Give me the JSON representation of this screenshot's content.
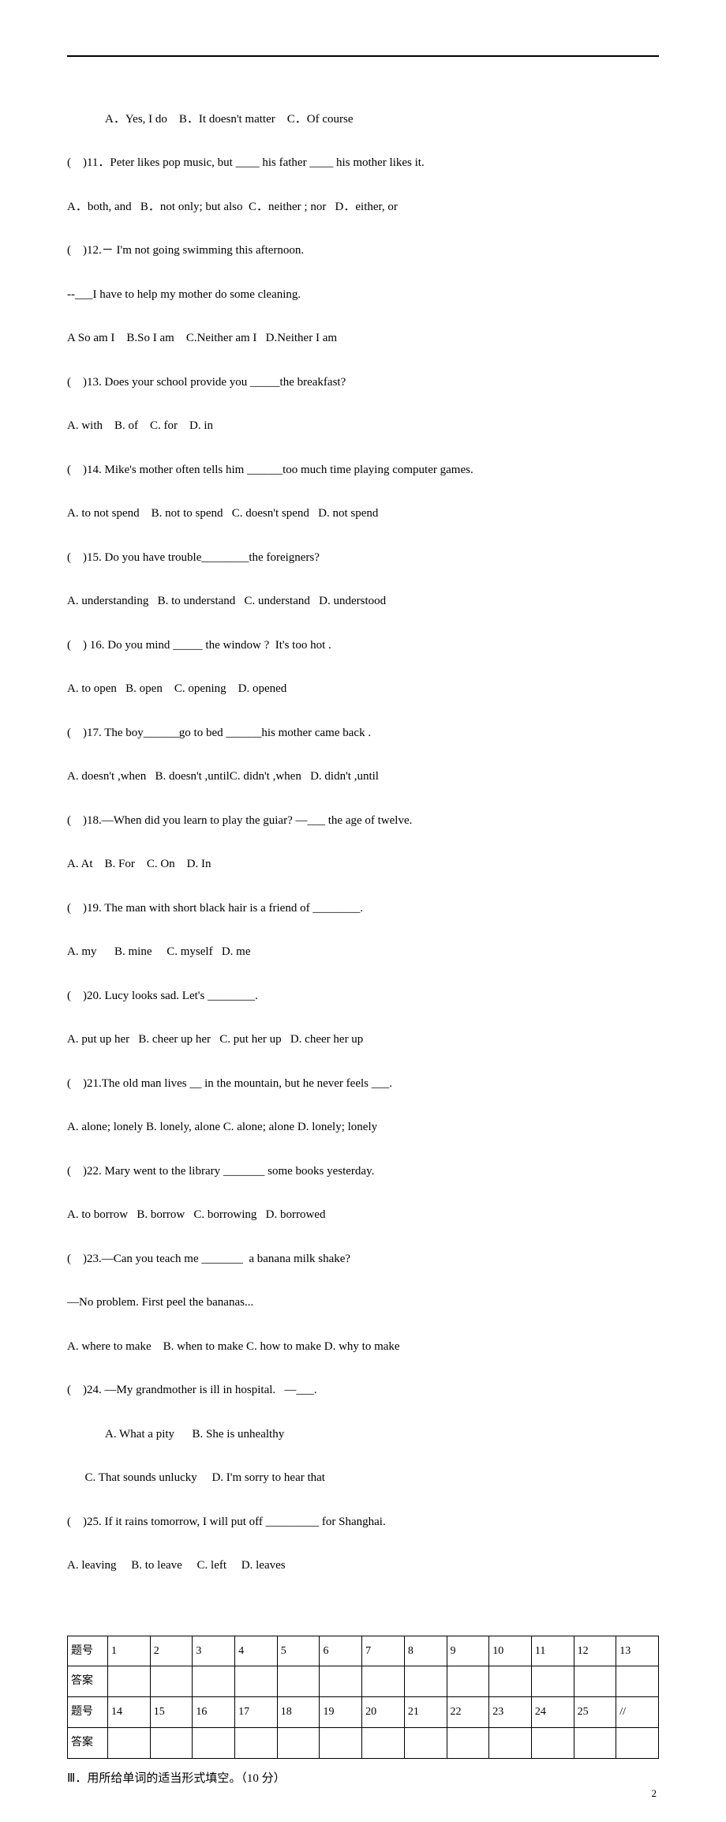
{
  "q10": {
    "indentA": "A．Yes, I do    B．It doesn't matter    C．Of course"
  },
  "q11": {
    "stem": "(    )11．Peter likes pop music, but ____ his father ____ his mother likes it.",
    "opts": "A．both, and   B．not only; but also  C．neither ; nor   D．either, or"
  },
  "q12": {
    "stem": "(    )12.－ I'm not going swimming this afternoon.",
    "cont": "--___I have to help my mother do some cleaning.",
    "opts": "A So am I    B.So I am    C.Neither am I   D.Neither I am"
  },
  "q13": {
    "stem": "(    )13. Does your school provide you _____the breakfast?",
    "opts": "A. with    B. of    C. for    D. in"
  },
  "q14": {
    "stem": "(    )14. Mike's mother often tells him ______too much time playing computer games.",
    "opts": "A. to not spend    B. not to spend   C. doesn't spend   D. not spend"
  },
  "q15": {
    "stem": "(    )15. Do you have trouble________the foreigners?",
    "opts": "A. understanding   B. to understand   C. understand   D. understood"
  },
  "q16": {
    "stem": "(    ) 16. Do you mind _____ the window ?  It's too hot .",
    "opts": "A. to open   B. open    C. opening    D. opened"
  },
  "q17": {
    "stem": "(    )17. The boy______go to bed ______his mother came back .",
    "opts": "A. doesn't ,when   B. doesn't ,untilC. didn't ,when   D. didn't ,until"
  },
  "q18": {
    "stem": "(    )18.—When did you learn to play the guiar? —___ the age of twelve.",
    "opts": "A. At    B. For    C. On    D. In"
  },
  "q19": {
    "stem": "(    )19. The man with short black hair is a friend of ________.",
    "opts": "A. my      B. mine     C. myself   D. me"
  },
  "q20": {
    "stem": "(    )20. Lucy looks sad. Let's ________.",
    "opts": "A. put up her   B. cheer up her   C. put her up   D. cheer her up"
  },
  "q21": {
    "stem": "(    )21.The old man lives __ in the mountain, but he never feels ___.",
    "opts": "A. alone; lonely B. lonely, alone C. alone; alone D. lonely; lonely"
  },
  "q22": {
    "stem": "(    )22. Mary went to the library _______ some books yesterday.",
    "opts": "A. to borrow   B. borrow   C. borrowing   D. borrowed"
  },
  "q23": {
    "stem": "(    )23.—Can you teach me _______  a banana milk shake?",
    "cont": "—No problem. First peel the bananas...",
    "opts": "A. where to make    B. when to make C. how to make D. why to make"
  },
  "q24": {
    "stem": "(    )24. —My grandmother is ill in hospital.   —___.",
    "optsA": "A. What a pity      B. She is unhealthy",
    "optsB": "C. That sounds unlucky     D. I'm sorry to hear that"
  },
  "q25": {
    "stem": "(    )25. If it rains tomorrow, I will put off _________ for Shanghai.",
    "opts": "A. leaving     B. to leave     C. left     D. leaves"
  },
  "table": {
    "row1Label": "题号",
    "row1": [
      "1",
      "2",
      "3",
      "4",
      "5",
      "6",
      "7",
      "8",
      "9",
      "10",
      "11",
      "12",
      "13"
    ],
    "row2Label": "答案",
    "row3Label": "题号",
    "row3": [
      "14",
      "15",
      "16",
      "17",
      "18",
      "19",
      "20",
      "21",
      "22",
      "23",
      "24",
      "25",
      "//"
    ],
    "row4Label": "答案"
  },
  "section3": "Ⅲ．用所给单词的适当形式填空。（10 分）",
  "pageNum": "2"
}
